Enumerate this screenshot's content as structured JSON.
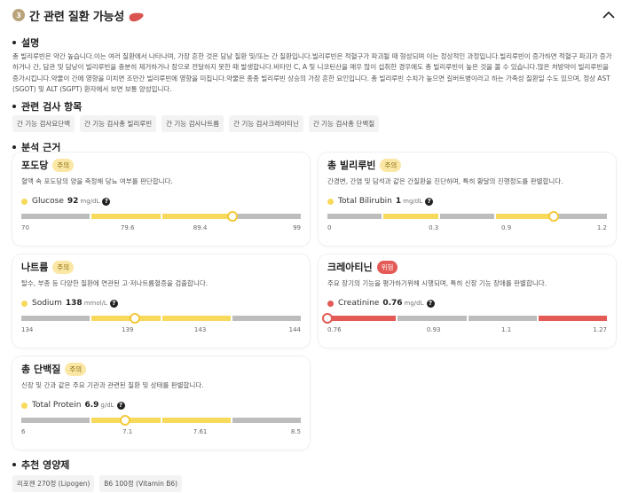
{
  "header": {
    "badge": "3",
    "title": "간 관련 질환 가능성",
    "icon": "liver-icon",
    "collapse_icon": "chevron-up-icon"
  },
  "sections": {
    "description_title": "설명",
    "tests_title": "관련 검사 항목",
    "basis_title": "분석 근거",
    "nutrients_title": "추천 영양제"
  },
  "description": "총 빌리루빈은 약간 높습니다.이는 여러 질환에서 나타나며, 가장 흔한 것은 담낭 질환 및/또는 간 질환입니다.빌리루빈은 적혈구가 파괴될 때 형성되며 이는 정상적인 과정입니다.빌리루빈이 증가하면 적혈구 파괴가 증가하거나 간, 담관 및 담낭이 빌리루빈을 충분히 제거하거나 장으로 전달하지 못한 때 발생합니다.비타민 C, A 및 니코틴산을 매우 많이 섭취한 경우에도 총 빌리루빈이 높은 것을 볼 수 있습니다.많은 처방약이 빌리루빈을 증가시킵니다.약물이 간에 영향을 미치면 조만간 빌리루빈에 영향을 미칩니다.약물은 종종 빌리루빈 상승의 가장 흔한 요인입니다. 총 빌리루빈 수치가 높으면 길버트병이라고 하는 가족성 질환일 수도 있으며, 정상 AST (SGOT) 및 ALT (SGPT) 환자에서 보면 보통 양성입니다.",
  "tests": [
    "간 기능 검사요단백",
    "간 기능 검사총 빌리루빈",
    "간 기능 검사나트륨",
    "간 기능 검사크레아티닌",
    "간 기능 검사총 단백질"
  ],
  "cards": [
    {
      "title": "포도당",
      "status": "주의",
      "status_type": "caution",
      "desc": "혈액 속 포도당의 양을 측정해 당뇨 여부를 판단합니다.",
      "metric_name": "Glucose",
      "value": "92",
      "unit": "mg/dL",
      "ticks": [
        "70",
        "79.6",
        "89.4",
        "99"
      ],
      "segments": [
        "gray",
        "yellow",
        "yellow",
        "gray"
      ],
      "marker_pos": 0.755,
      "marker_color": "yellow"
    },
    {
      "title": "총 빌리루빈",
      "status": "주의",
      "status_type": "caution",
      "desc": "간경변, 간염 및 담석과 같은 간질환을 진단하며, 특히 황달의 진행정도를 판별합니다.",
      "metric_name": "Total Bilirubin",
      "value": "1",
      "unit": "mg/dL",
      "ticks": [
        "0",
        "0.3",
        "0.9",
        "1.2"
      ],
      "segments": [
        "gray",
        "yellow",
        "gray",
        "yellow",
        "gray"
      ],
      "marker_pos": 0.81,
      "marker_color": "yellow"
    },
    {
      "title": "나트륨",
      "status": "주의",
      "status_type": "caution",
      "desc": "탈수, 부종 등 다양한 질환에 연관된 고·저나트륨혈증을 검출합니다.",
      "metric_name": "Sodium",
      "value": "138",
      "unit": "mmol/L",
      "ticks": [
        "134",
        "139",
        "143",
        "144"
      ],
      "segments": [
        "gray",
        "yellow",
        "yellow",
        "gray"
      ],
      "marker_pos": 0.405,
      "marker_color": "yellow"
    },
    {
      "title": "크레아티닌",
      "status": "위험",
      "status_type": "danger",
      "desc": "주요 장기의 기능을 평가하기위해 시행되며, 특히 신장 기능 장애를 판별합니다.",
      "metric_name": "Creatinine",
      "value": "0.76",
      "unit": "mg/dL",
      "ticks": [
        "0.76",
        "0.93",
        "1.1",
        "1.27"
      ],
      "segments": [
        "red",
        "gray",
        "gray",
        "red"
      ],
      "marker_pos": 0.0,
      "marker_color": "red"
    },
    {
      "title": "총 단백질",
      "status": "주의",
      "status_type": "caution",
      "desc": "신장 및 간과 같은 주요 기관과 관련된 질환 및 상태를 판별합니다.",
      "metric_name": "Total Protein",
      "value": "6.9",
      "unit": "g/dL",
      "ticks": [
        "6",
        "7.1",
        "7.61",
        "8.5"
      ],
      "segments": [
        "gray",
        "yellow",
        "yellow",
        "gray"
      ],
      "marker_pos": 0.37,
      "marker_color": "yellow"
    }
  ],
  "nutrients": [
    "리포젠 270정 (Lipogen)",
    "B6 100정 (Vitamin B6)"
  ]
}
